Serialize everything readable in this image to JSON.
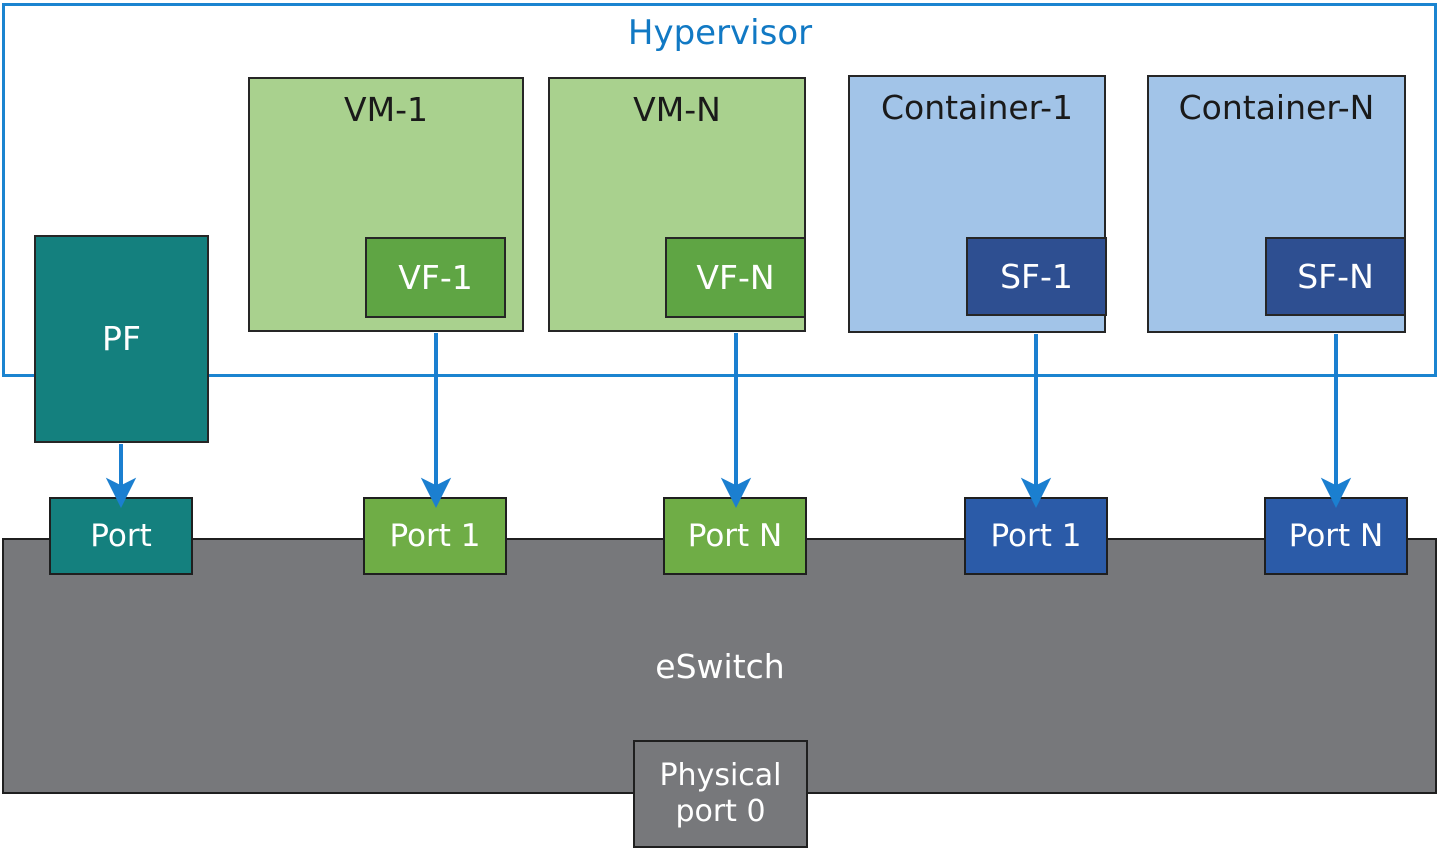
{
  "diagram": {
    "title": "Hypervisor",
    "title_color": "#1179C4",
    "hypervisor": {
      "label": "Hypervisor",
      "border_color": "#1B84D0"
    },
    "nodes": [
      {
        "id": "pf",
        "label": "PF",
        "fill": "#14807E",
        "text_color": "#ffffff"
      },
      {
        "id": "vm-1",
        "label": "VM-1",
        "fill": "#A9D18E",
        "text_color": "#1a1a1a"
      },
      {
        "id": "vm-n",
        "label": "VM-N",
        "fill": "#A9D18E",
        "text_color": "#1a1a1a"
      },
      {
        "id": "container-1",
        "label": "Container-1",
        "fill": "#A2C4E8",
        "text_color": "#1a1a1a"
      },
      {
        "id": "container-n",
        "label": "Container-N",
        "fill": "#A2C4E8",
        "text_color": "#1a1a1a"
      },
      {
        "id": "vf-1",
        "label": "VF-1",
        "fill": "#5FA544",
        "text_color": "#ffffff"
      },
      {
        "id": "vf-n",
        "label": "VF-N",
        "fill": "#5FA544",
        "text_color": "#ffffff"
      },
      {
        "id": "sf-1",
        "label": "SF-1",
        "fill": "#2E4F91",
        "text_color": "#ffffff"
      },
      {
        "id": "sf-n",
        "label": "SF-N",
        "fill": "#2E4F91",
        "text_color": "#ffffff"
      }
    ],
    "switch": {
      "label": "eSwitch",
      "fill": "#77787B",
      "physical_port": {
        "line1": "Physical",
        "line2": "port 0"
      }
    },
    "ports": [
      {
        "id": "port-pf",
        "label": "Port",
        "fill": "#14807E",
        "source": "pf"
      },
      {
        "id": "port-v1",
        "label": "Port 1",
        "fill": "#6FAD46",
        "source": "vm-1"
      },
      {
        "id": "port-vn",
        "label": "Port N",
        "fill": "#6FAD46",
        "source": "vm-n"
      },
      {
        "id": "port-c1",
        "label": "Port 1",
        "fill": "#2B5BA8",
        "source": "container-1"
      },
      {
        "id": "port-cn",
        "label": "Port N",
        "fill": "#2B5BA8",
        "source": "container-n"
      }
    ],
    "connector_color": "#1B7FD0"
  }
}
